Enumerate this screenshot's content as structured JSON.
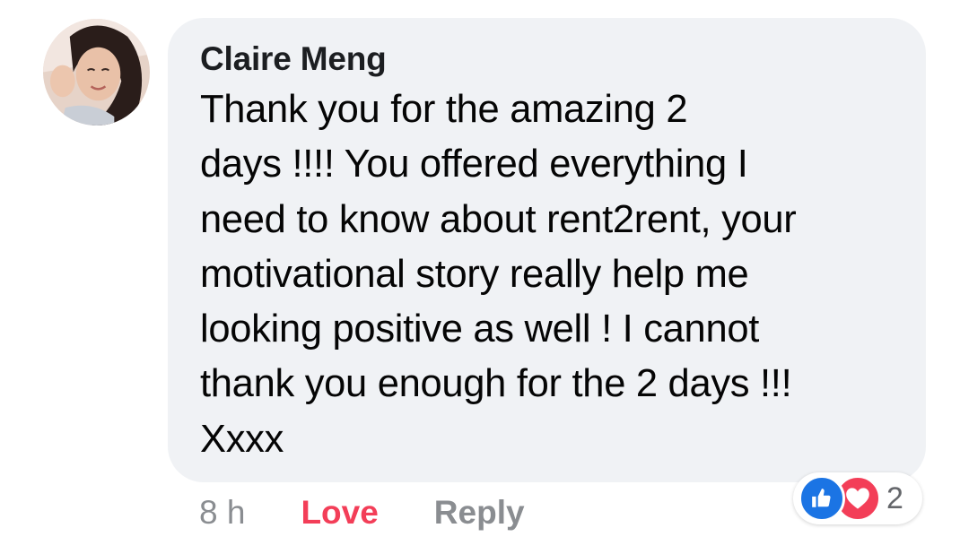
{
  "comment": {
    "author": "Claire Meng",
    "text_lines": [
      "Thank you for the amazing 2",
      "days !!!! You offered everything I",
      "need to know about rent2rent, your",
      "motivational story really help me",
      "looking positive as well ! I cannot",
      "thank you enough for the 2 days !!!",
      "Xxxx"
    ],
    "timestamp": "8 h",
    "love_label": "Love",
    "reply_label": "Reply",
    "reactions": {
      "icons": [
        "like-icon",
        "love-icon"
      ],
      "count": "2"
    }
  },
  "colors": {
    "bubble": "#f0f2f5",
    "love": "#f33e58",
    "like": "#1b74e4",
    "muted": "#8a8d91"
  }
}
